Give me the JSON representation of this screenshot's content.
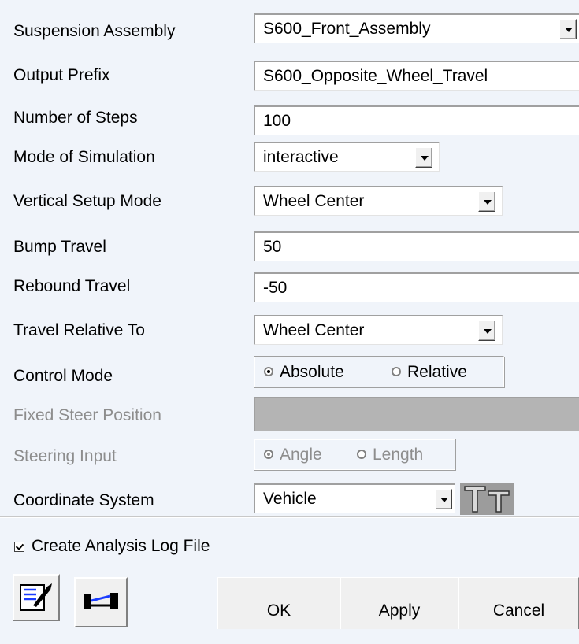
{
  "form": {
    "suspension_assembly": {
      "label": "Suspension Assembly",
      "value": "S600_Front_Assembly"
    },
    "output_prefix": {
      "label": "Output Prefix",
      "value": "S600_Opposite_Wheel_Travel"
    },
    "number_of_steps": {
      "label": "Number of Steps",
      "value": "100"
    },
    "mode_of_simulation": {
      "label": "Mode of Simulation",
      "value": "interactive"
    },
    "vertical_setup_mode": {
      "label": "Vertical Setup Mode",
      "value": "Wheel Center"
    },
    "bump_travel": {
      "label": "Bump Travel",
      "value": "50"
    },
    "rebound_travel": {
      "label": "Rebound Travel",
      "value": "-50"
    },
    "travel_relative_to": {
      "label": "Travel Relative To",
      "value": "Wheel Center"
    },
    "control_mode": {
      "label": "Control Mode",
      "options": [
        "Absolute",
        "Relative"
      ],
      "selected": "Absolute"
    },
    "fixed_steer_position": {
      "label": "Fixed Steer Position",
      "value": ""
    },
    "steering_input": {
      "label": "Steering Input",
      "options": [
        "Angle",
        "Length"
      ],
      "selected": "Angle"
    },
    "coordinate_system": {
      "label": "Coordinate System",
      "value": "Vehicle"
    }
  },
  "create_log": {
    "label": "Create Analysis Log File",
    "checked": true
  },
  "buttons": {
    "ok": "OK",
    "apply": "Apply",
    "cancel": "Cancel"
  },
  "icons": {
    "comment": "comment-edit-icon",
    "suspension": "suspension-view-icon",
    "coordinate": "coordinate-system-icon"
  }
}
